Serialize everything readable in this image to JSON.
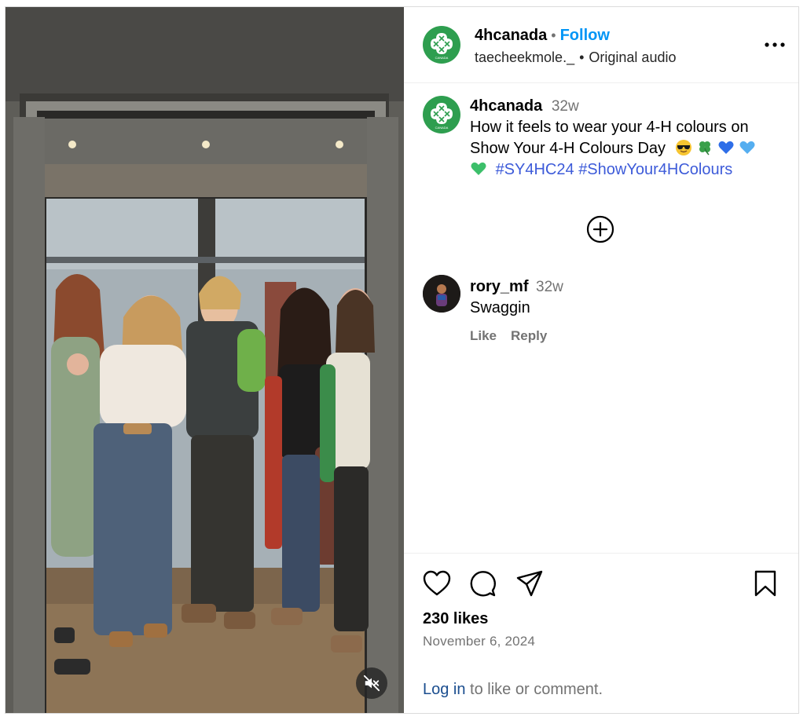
{
  "post": {
    "username": "4hcanada",
    "follow_label": "Follow",
    "dot": "•",
    "audio_user": "taecheekmole._",
    "audio_label": "Original audio",
    "logo_text": "CANADA"
  },
  "caption": {
    "username": "4hcanada",
    "time": "32w",
    "text": "How it feels to wear your 4-H colours on Show Your 4-H Colours Day",
    "emojis": [
      "smiling-face-with-sunglasses",
      "four-leaf-clover",
      "blue-heart",
      "light-blue-heart",
      "green-heart"
    ],
    "hashtags": [
      "#SY4HC24",
      "#ShowYour4HColours"
    ]
  },
  "comment": {
    "username": "rory_mf",
    "time": "32w",
    "text": "Swaggin",
    "like_label": "Like",
    "reply_label": "Reply"
  },
  "footer": {
    "likes": "230 likes",
    "date": "November 6, 2024",
    "login_link": "Log in",
    "login_rest": " to like or comment."
  },
  "icons": {
    "more": "more-options-icon",
    "load_more": "plus-circle-icon",
    "like": "heart-icon",
    "comment": "comment-icon",
    "share": "share-icon",
    "save": "bookmark-icon",
    "mute": "muted-speaker-icon"
  },
  "colors": {
    "brand_green": "#2e9e4f",
    "follow_blue": "#0095f6",
    "hashtag_blue": "#3d5bd9",
    "muted_gray": "#737373"
  }
}
